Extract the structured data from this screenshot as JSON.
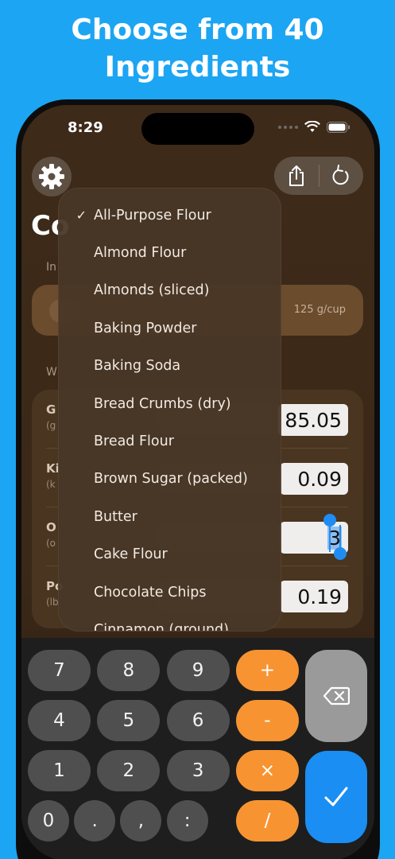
{
  "promo": {
    "line1": "Choose from 40",
    "line2": "Ingredients"
  },
  "status_bar": {
    "time": "8:29"
  },
  "header": {
    "title_partial": "Co",
    "ingredient_label_partial": "In",
    "weights_label_partial": "W"
  },
  "ingredient_card": {
    "density": "125 g/cup"
  },
  "weights": [
    {
      "name_partial": "G",
      "abbr_partial": "(g",
      "value": "85.05",
      "selected": false
    },
    {
      "name_partial": "Ki",
      "abbr_partial": "(k",
      "value": "0.09",
      "selected": false
    },
    {
      "name_partial": "O",
      "abbr_partial": "(o",
      "value": "3",
      "selected": true
    },
    {
      "name_partial": "Po",
      "abbr_partial": "(lb",
      "value": "0.19",
      "selected": false
    }
  ],
  "ingredient_menu": {
    "selected": "All-Purpose Flour",
    "check_glyph": "✓",
    "items": [
      "All-Purpose Flour",
      "Almond Flour",
      "Almonds (sliced)",
      "Baking Powder",
      "Baking Soda",
      "Bread Crumbs (dry)",
      "Bread Flour",
      "Brown Sugar (packed)",
      "Butter",
      "Cake Flour",
      "Chocolate Chips",
      "Cinnamon (ground)"
    ]
  },
  "keypad": {
    "keys": [
      {
        "label": "7",
        "kind": "digit"
      },
      {
        "label": "8",
        "kind": "digit"
      },
      {
        "label": "9",
        "kind": "digit"
      },
      {
        "label": "+",
        "kind": "op"
      },
      {
        "label": "4",
        "kind": "digit"
      },
      {
        "label": "5",
        "kind": "digit"
      },
      {
        "label": "6",
        "kind": "digit"
      },
      {
        "label": "-",
        "kind": "op"
      },
      {
        "label": "1",
        "kind": "digit"
      },
      {
        "label": "2",
        "kind": "digit"
      },
      {
        "label": "3",
        "kind": "digit"
      },
      {
        "label": "×",
        "kind": "op"
      },
      {
        "label": "0",
        "kind": "digit"
      },
      {
        "label": ".",
        "kind": "digit"
      },
      {
        "label": ",",
        "kind": "digit"
      },
      {
        "label": ":",
        "kind": "digit"
      },
      {
        "label": "/",
        "kind": "op"
      }
    ]
  },
  "icons": {
    "settings": "gear-icon",
    "share": "share-icon",
    "reset": "undo-arrow-icon",
    "backspace": "backspace-icon",
    "confirm": "checkmark-icon"
  },
  "colors": {
    "background": "#1ca5f2",
    "operator": "#f79431",
    "confirm": "#1a8ef2",
    "backspace": "#9a9a9a",
    "selection": "#1f8cf1"
  }
}
